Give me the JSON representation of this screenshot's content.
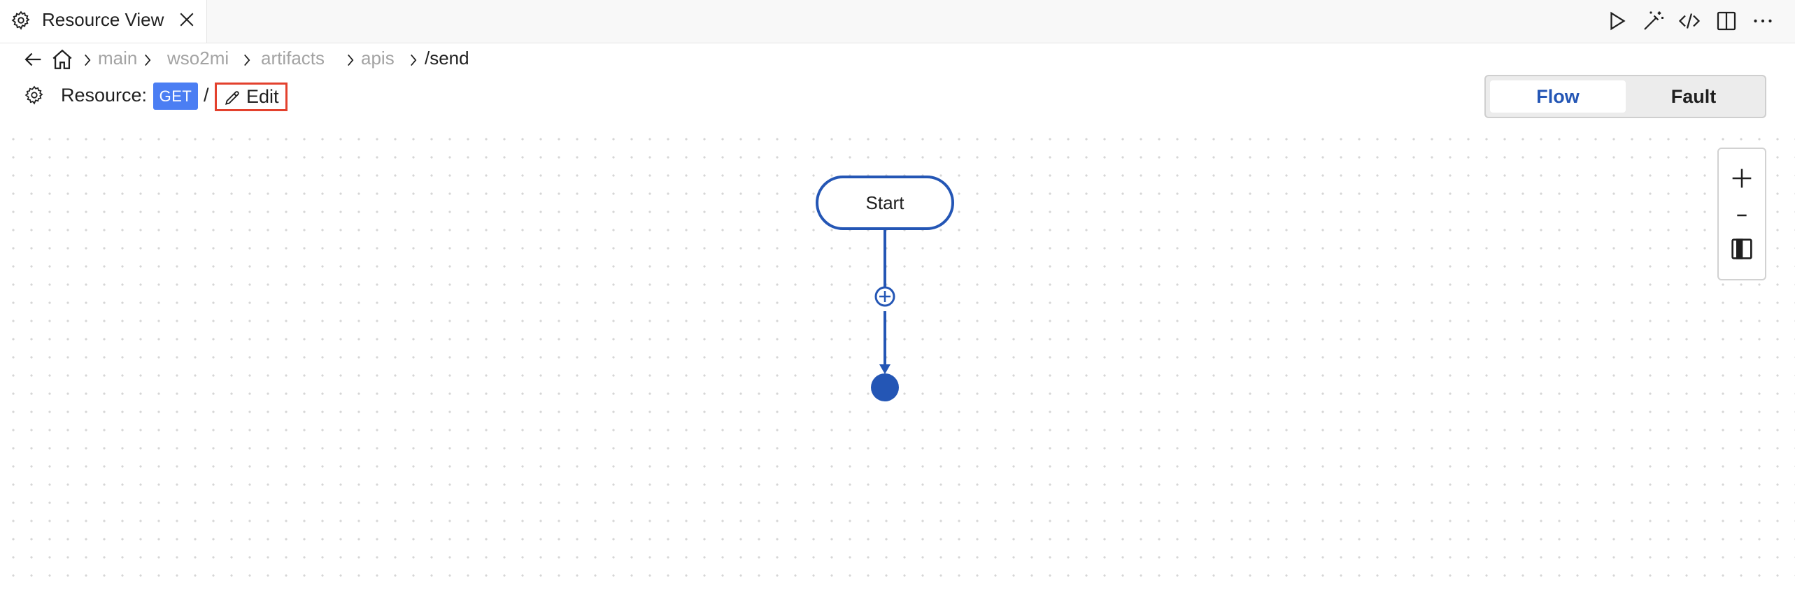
{
  "tab": {
    "title": "Resource View",
    "icon": "gear-icon",
    "close_icon": "close-icon"
  },
  "toolbar": {
    "icons": [
      "play-icon",
      "magic-wand-icon",
      "code-icon",
      "split-editor-icon",
      "more-icon"
    ]
  },
  "breadcrumb": {
    "items": [
      "main",
      "wso2mi",
      "artifacts",
      "apis"
    ],
    "current": "/send"
  },
  "resource": {
    "label": "Resource:",
    "method": "GET",
    "slash": "/",
    "edit_label": "Edit"
  },
  "view_toggle": {
    "options": [
      "Flow",
      "Fault"
    ],
    "selected": "Flow"
  },
  "diagram": {
    "start_label": "Start"
  },
  "zoom": {
    "zoom_in": "+",
    "zoom_out": "-"
  },
  "colors": {
    "accent": "#2456b5",
    "method_badge": "#4b7ef3",
    "edit_highlight": "#e3412d"
  }
}
